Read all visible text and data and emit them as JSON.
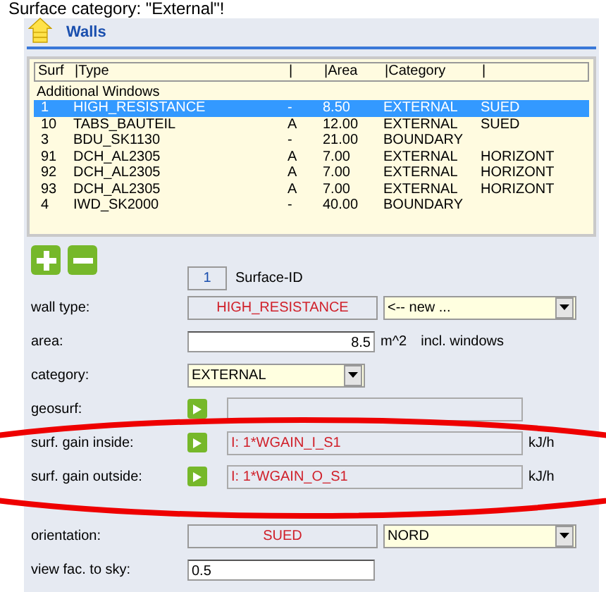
{
  "caption": "Surface category: \"External\"!",
  "header": {
    "title": "Walls"
  },
  "table": {
    "columns": [
      "Surf",
      "|Type",
      "|",
      "|Area",
      "|Category",
      "|"
    ],
    "group": "Additional Windows",
    "rows": [
      {
        "cells": [
          "1",
          "HIGH_RESISTANCE",
          "-",
          "8.50",
          "EXTERNAL",
          "SUED"
        ],
        "selected": true
      },
      {
        "cells": [
          "10",
          "TABS_BAUTEIL",
          "A",
          "12.00",
          "EXTERNAL",
          "SUED"
        ],
        "selected": false
      },
      {
        "cells": [
          "3",
          "BDU_SK1130",
          "-",
          "21.00",
          "BOUNDARY",
          ""
        ],
        "selected": false
      },
      {
        "cells": [
          "91",
          "DCH_AL2305",
          "A",
          "7.00",
          "EXTERNAL",
          "HORIZONT"
        ],
        "selected": false
      },
      {
        "cells": [
          "92",
          "DCH_AL2305",
          "A",
          "7.00",
          "EXTERNAL",
          "HORIZONT"
        ],
        "selected": false
      },
      {
        "cells": [
          "93",
          "DCH_AL2305",
          "A",
          "7.00",
          "EXTERNAL",
          "HORIZONT"
        ],
        "selected": false
      },
      {
        "cells": [
          "4",
          "IWD_SK2000",
          "-",
          "40.00",
          "BOUNDARY",
          ""
        ],
        "selected": false
      }
    ]
  },
  "tools": [
    {
      "kind": "add"
    },
    {
      "kind": "remove"
    }
  ],
  "surface_id": {
    "value": "1",
    "label": "Surface-ID"
  },
  "fields": [
    {
      "kind": "readonly_select",
      "label": "wall type:",
      "value": "HIGH_RESISTANCE",
      "option": "<-- new ..."
    },
    {
      "kind": "input",
      "label": "area:",
      "value": "8.5",
      "unit": "m^2",
      "note": "incl. windows"
    },
    {
      "kind": "select",
      "label": "category:",
      "value": "EXTERNAL"
    },
    {
      "kind": "formula",
      "label": "geosurf:"
    },
    {
      "kind": "formula",
      "label": "surf. gain inside:",
      "value": "I: 1*WGAIN_I_S1",
      "unit": "kJ/h"
    },
    {
      "kind": "formula",
      "label": "surf. gain outside:",
      "value": "I: 1*WGAIN_O_S1",
      "unit": "kJ/h"
    }
  ],
  "placement_fields": [
    {
      "kind": "readonly_select",
      "label": "orientation:",
      "value": "SUED",
      "option": "NORD"
    },
    {
      "kind": "input_left",
      "label": "view fac. to sky:",
      "value": "0.5"
    }
  ]
}
